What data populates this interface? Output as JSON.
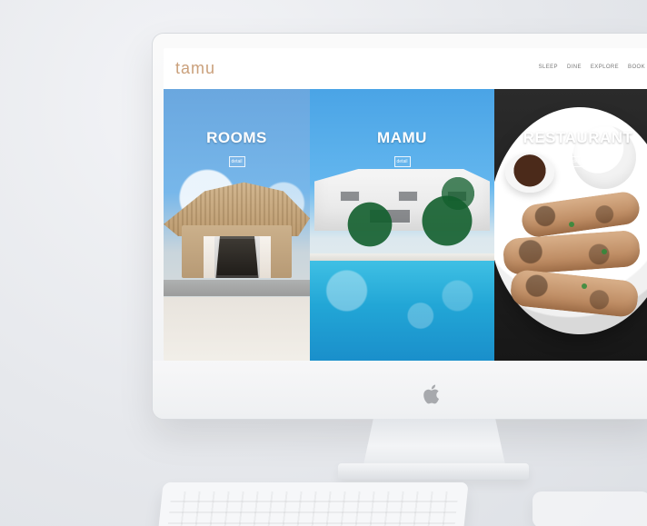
{
  "site": {
    "brand": "tamu",
    "nav": [
      "SLEEP",
      "DINE",
      "EXPLORE",
      "BOOK"
    ],
    "panels": [
      {
        "title": "ROOMS",
        "button": "detail"
      },
      {
        "title": "MAMU",
        "button": "detail"
      },
      {
        "title": "RESTAURANT",
        "button": "detail"
      }
    ]
  },
  "icons": {
    "apple": "apple-logo-icon"
  },
  "colors": {
    "brand_accent": "#caa07b"
  }
}
